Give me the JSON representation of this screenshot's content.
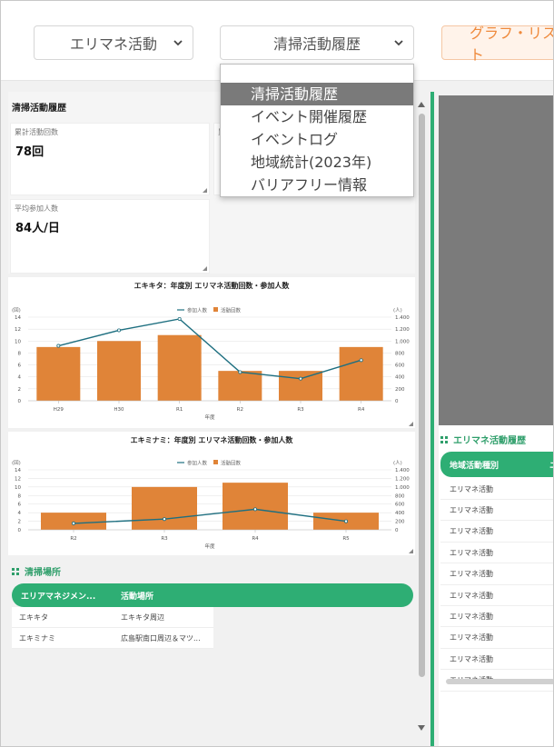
{
  "header": {
    "select_area": "エリマネ活動",
    "select_view": "清掃活動履歴",
    "view_toggle": "グラフ・リスト"
  },
  "dropdown": {
    "options": [
      "清掃活動履歴",
      "イベント開催履歴",
      "イベントログ",
      "地域統計(2023年)",
      "バリアフリー情報"
    ],
    "selected_index": 0
  },
  "left": {
    "section_title": "清掃活動履歴",
    "kpis": [
      {
        "label": "累計活動回数",
        "value": "78回"
      },
      {
        "label": "平均参加人数",
        "value": "84人/日"
      }
    ]
  },
  "chart_data": [
    {
      "type": "bar",
      "title": "エキキタ：年度別 エリマネ活動回数・参加人数",
      "categories": [
        "H29",
        "H30",
        "R1",
        "R2",
        "R3",
        "R4"
      ],
      "series": [
        {
          "name": "活動回数",
          "kind": "bar",
          "axis": "left",
          "color": "#e08438",
          "values": [
            9,
            10,
            11,
            5,
            5,
            9
          ]
        },
        {
          "name": "参加人数",
          "kind": "line",
          "axis": "right",
          "color": "#1e6f80",
          "values": [
            920,
            1180,
            1370,
            480,
            370,
            680
          ]
        }
      ],
      "xlabel": "年度",
      "ylabel_left": "(回)",
      "ylabel_right": "(人)",
      "ylim_left": [
        0,
        14
      ],
      "ylim_right": [
        0,
        1400
      ],
      "yticks_left": [
        "0",
        "2",
        "4",
        "6",
        "8",
        "10",
        "12",
        "14"
      ],
      "yticks_right": [
        "0",
        "200",
        "400",
        "600",
        "800",
        "1.000",
        "1.200",
        "1.400"
      ],
      "legend": "top"
    },
    {
      "type": "bar",
      "title": "エキミナミ：年度別 エリマネ活動回数・参加人数",
      "categories": [
        "R2",
        "R3",
        "R4",
        "R5"
      ],
      "series": [
        {
          "name": "活動回数",
          "kind": "bar",
          "axis": "left",
          "color": "#e08438",
          "values": [
            4,
            10,
            11,
            4
          ]
        },
        {
          "name": "参加人数",
          "kind": "line",
          "axis": "right",
          "color": "#1e6f80",
          "values": [
            150,
            250,
            480,
            200
          ]
        }
      ],
      "xlabel": "年度",
      "ylabel_left": "(回)",
      "ylabel_right": "(人)",
      "ylim_left": [
        0,
        14
      ],
      "ylim_right": [
        0,
        1400
      ],
      "yticks_left": [
        "0",
        "2",
        "4",
        "6",
        "8",
        "10",
        "12",
        "14"
      ],
      "yticks_right": [
        "0",
        "200",
        "400",
        "600",
        "800",
        "1.000",
        "1.200",
        "1.400"
      ],
      "legend": "top"
    }
  ],
  "cleaning_places": {
    "title": "清掃場所",
    "headers": [
      "エリアマネジメン...",
      "活動場所"
    ],
    "rows": [
      [
        "エキキタ",
        "エキキタ周辺"
      ],
      [
        "エキミナミ",
        "広島駅南口周辺＆マツ..."
      ]
    ]
  },
  "right": {
    "title": "エリマネ活動履歴",
    "header": "地域活動種別",
    "header_extra": "ニ",
    "rows": [
      "エリマネ活動",
      "エリマネ活動",
      "エリマネ活動",
      "エリマネ活動",
      "エリマネ活動",
      "エリマネ活動",
      "エリマネ活動",
      "エリマネ活動",
      "エリマネ活動",
      "エリマネ活動"
    ]
  },
  "colors": {
    "accent": "#2eae74",
    "bar": "#e08438",
    "line": "#1e6f80",
    "toggle": "#ef8a3c"
  }
}
